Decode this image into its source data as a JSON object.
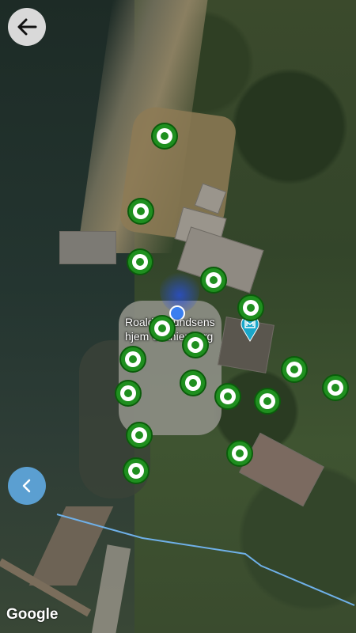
{
  "map": {
    "type": "satellite",
    "poi_label_line1": "Roald Amundsens",
    "poi_label_line2": "hjem Uranienborg",
    "attribution": "Google",
    "my_location_color": "#3a7ff0",
    "marker_color": "#1f8f1f",
    "marker_count": 16
  },
  "controls": {
    "back_icon": "arrow-left-icon",
    "side_panel_icon": "chevron-left-icon",
    "side_panel_color": "#5b9fd1"
  }
}
